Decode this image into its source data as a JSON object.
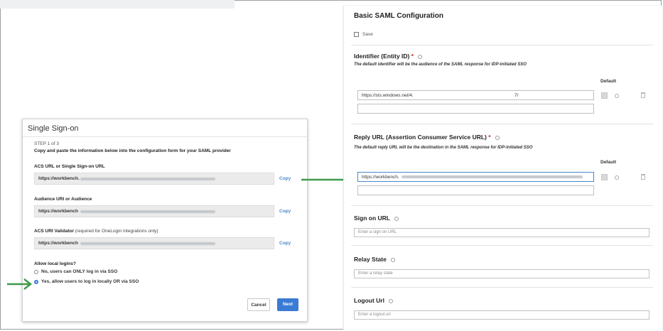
{
  "sso_dialog": {
    "title": "Single Sign-on",
    "step": "STEP 1 of 3",
    "instruction": "Copy and paste the information below into the configuration form for your SAML provider",
    "fields": [
      {
        "label": "ACS URL or Single Sign-on URL",
        "note": "",
        "value": "https://workbench.",
        "copy_label": "Copy"
      },
      {
        "label": "Audience URI or Audience",
        "note": "",
        "value": "https://workbench",
        "copy_label": "Copy"
      },
      {
        "label": "ACS URI Validator",
        "note": "(required for OneLogin integrations only)",
        "value": "https://workbench",
        "copy_label": "Copy"
      }
    ],
    "local_logins": {
      "label": "Allow local logins?",
      "options": [
        {
          "label": "No, users can ONLY log in via SSO",
          "selected": false
        },
        {
          "label": "Yes, allow users to log in locally OR via SSO",
          "selected": true
        }
      ]
    },
    "cancel_label": "Cancel",
    "next_label": "Next"
  },
  "saml_config": {
    "title": "Basic SAML Configuration",
    "save_label": "Save",
    "identifier": {
      "label": "Identifier (Entity ID)",
      "required": "*",
      "description": "The default identifier will be the audience of the SAML response for IDP-initiated SSO",
      "default_header": "Default",
      "value": "https://sts.windows.net/4.",
      "value_tail": "7/"
    },
    "reply_url": {
      "label": "Reply URL (Assertion Consumer Service URL)",
      "required": "*",
      "description": "The default reply URL will be the destination in the SAML response for IDP-initiated SSO",
      "default_header": "Default",
      "value": "https://workbench."
    },
    "sign_on_url": {
      "label": "Sign on URL",
      "placeholder": "Enter a sign on URL"
    },
    "relay_state": {
      "label": "Relay State",
      "placeholder": "Enter a relay state"
    },
    "logout_url": {
      "label": "Logout Url",
      "placeholder": "Enter a logout url"
    }
  },
  "colors": {
    "arrow": "#3f9a4a",
    "primary_button": "#3a7bd5",
    "copy_link": "#4a86c8",
    "required": "#c4262e"
  },
  "icons": [
    "save-icon",
    "info-icon",
    "checkbox-icon",
    "trash-icon",
    "radio-icon",
    "arrow-icon"
  ]
}
